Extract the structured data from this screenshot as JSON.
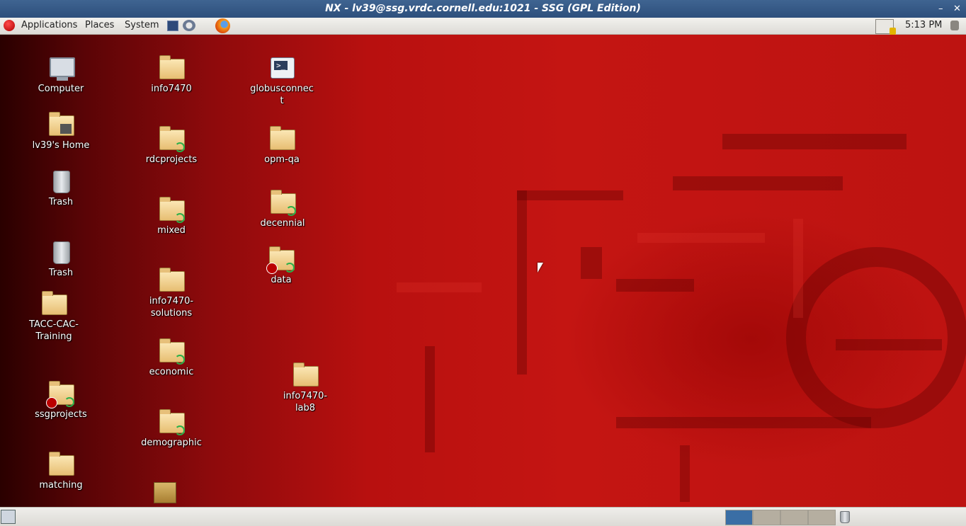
{
  "window": {
    "title": "NX - lv39@ssg.vrdc.cornell.edu:1021 - SSG (GPL Edition)",
    "minimize": "–",
    "close": "✕"
  },
  "top_panel": {
    "menus": [
      "Applications",
      "Places",
      "System"
    ],
    "launchers": [
      "terminal-icon",
      "printer-icon",
      "firefox-icon"
    ],
    "clock": "5:13 PM",
    "tray": [
      "network-icon",
      "volume-icon"
    ]
  },
  "desktop": {
    "icons": [
      {
        "label": "Computer",
        "type": "computer-icon"
      },
      {
        "label": "lv39's Home",
        "type": "home-folder-icon"
      },
      {
        "label": "Trash",
        "type": "trash-icon"
      },
      {
        "label": "Trash",
        "type": "trash-icon"
      },
      {
        "label": "TACC-CAC-Training",
        "type": "folder-icon"
      },
      {
        "label": "ssgprojects",
        "type": "folder-link-broken-icon"
      },
      {
        "label": "matching",
        "type": "folder-icon"
      },
      {
        "label": "info7470",
        "type": "folder-icon"
      },
      {
        "label": "rdcprojects",
        "type": "folder-link-icon"
      },
      {
        "label": "mixed",
        "type": "folder-link-icon"
      },
      {
        "label": "info7470-solutions",
        "type": "folder-icon"
      },
      {
        "label": "economic",
        "type": "folder-link-icon"
      },
      {
        "label": "demographic",
        "type": "folder-link-icon"
      },
      {
        "label": "",
        "type": "package-icon"
      },
      {
        "label": "globusconnect",
        "type": "application-icon"
      },
      {
        "label": "opm-qa",
        "type": "folder-icon"
      },
      {
        "label": "decennial",
        "type": "folder-link-icon"
      },
      {
        "label": "data",
        "type": "folder-link-broken-icon"
      },
      {
        "label": "info7470-lab8",
        "type": "folder-icon"
      }
    ]
  },
  "bottom_panel": {
    "workspaces": [
      {
        "name": "Workspace 1",
        "active": true
      },
      {
        "name": "Workspace 2",
        "active": false
      },
      {
        "name": "Workspace 3",
        "active": false
      },
      {
        "name": "Workspace 4",
        "active": false
      }
    ],
    "colors": {
      "active": "#3a6ea5",
      "inactive": "#b5aea0"
    }
  }
}
